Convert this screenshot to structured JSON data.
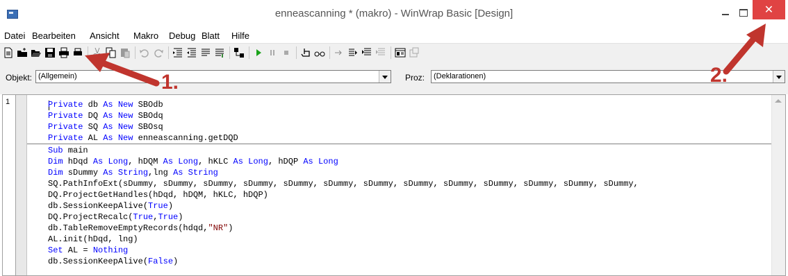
{
  "window": {
    "title": "enneascanning * (makro) - WinWrap Basic [Design]",
    "close_symbol": "✕",
    "accent_close": "#e04343"
  },
  "menu": [
    "Datei",
    "Bearbeiten",
    "Ansicht",
    "Makro",
    "Debug",
    "Blatt",
    "Hilfe"
  ],
  "toolbar_icons": [
    "new-file-icon",
    "new-folder-icon",
    "open-icon",
    "save-icon",
    "print-all-icon",
    "print-icon",
    "cut-icon",
    "copy-icon",
    "paste-icon",
    "undo-icon",
    "redo-icon",
    "indent-icon",
    "outdent-icon",
    "comment-icon",
    "uncomment-icon",
    "references-icon",
    "run-icon",
    "pause-icon",
    "stop-icon",
    "toggle-breakpoint-icon",
    "quick-watch-icon",
    "step-into-icon",
    "step-over-icon",
    "step-out-icon",
    "dialog-editor-icon",
    "properties-icon"
  ],
  "selectors": {
    "object_label": "Objekt:",
    "object_value": "(Allgemein)",
    "proc_label": "Proz:",
    "proc_value": "(Deklarationen)"
  },
  "editor": {
    "line_number": "1",
    "code_lines": [
      "Private db As New SBOdb",
      "Private DQ As New SBOdq",
      "Private SQ As New SBOsq",
      "Private AL As New enneascanning.getDQD",
      "Sub main",
      "Dim hDqd As Long, hDQM As Long, hKLC As Long, hDQP As Long",
      "Dim sDummy As String,lng As String",
      "SQ.PathInfoExt(sDummy, sDummy, sDummy, sDummy, sDummy, sDummy, sDummy, sDummy, sDummy, sDummy, sDummy, sDummy, sDummy,",
      "DQ.ProjectGetHandles(hDqd, hDQM, hKLC, hDQP)",
      "db.SessionKeepAlive(True)",
      "DQ.ProjectRecalc(True,True)",
      "db.TableRemoveEmptyRecords(hdqd,\"NR\")",
      "AL.init(hDqd, lng)",
      "Set AL = Nothing",
      "db.SessionKeepAlive(False)"
    ]
  },
  "annotations": {
    "label_1": "1.",
    "label_2": "2.",
    "color": "#c0352e"
  }
}
